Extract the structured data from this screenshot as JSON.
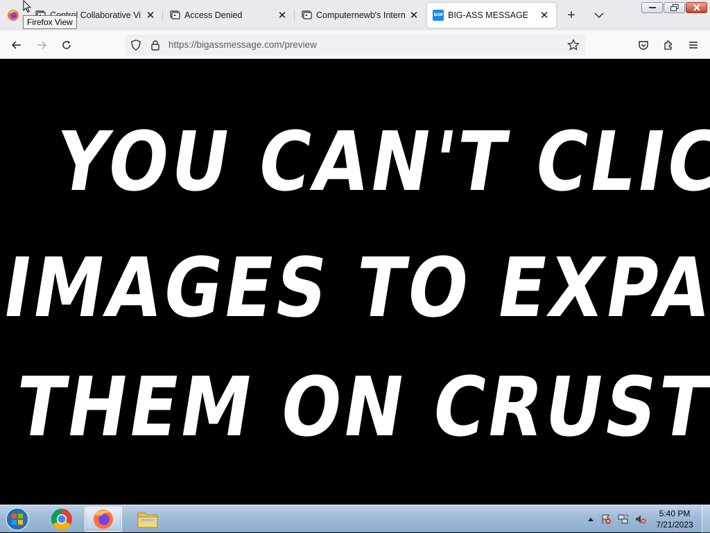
{
  "browser": {
    "firefox_view_tooltip": "Firefox View",
    "tabs": [
      {
        "title": "Control Collaborative Vir",
        "icon": "vm-icon"
      },
      {
        "title": "Access Denied",
        "icon": "vm-icon"
      },
      {
        "title": "Computernewb's Interne",
        "icon": "vm-icon"
      },
      {
        "title": "BIG-ASS MESSAGE",
        "icon": "bam-icon",
        "favicon_text": "BAM",
        "active": true
      }
    ],
    "new_tab_label": "+",
    "url": "https://bigassmessage.com/preview"
  },
  "page": {
    "lines": [
      "YOU CAN'T CLICK",
      "IMAGES TO EXPAND",
      "THEM ON CRUSTYW"
    ],
    "background": "#000000",
    "text_color": "#ffffff"
  },
  "taskbar": {
    "time": "5:40 PM",
    "date": "7/21/2023",
    "apps": [
      "start-orb",
      "chrome",
      "firefox",
      "file-explorer"
    ]
  },
  "colors": {
    "favicon_blue": "#1e88e5",
    "tabstrip": "#e9e9ee",
    "navbar": "#f9f9fb"
  }
}
